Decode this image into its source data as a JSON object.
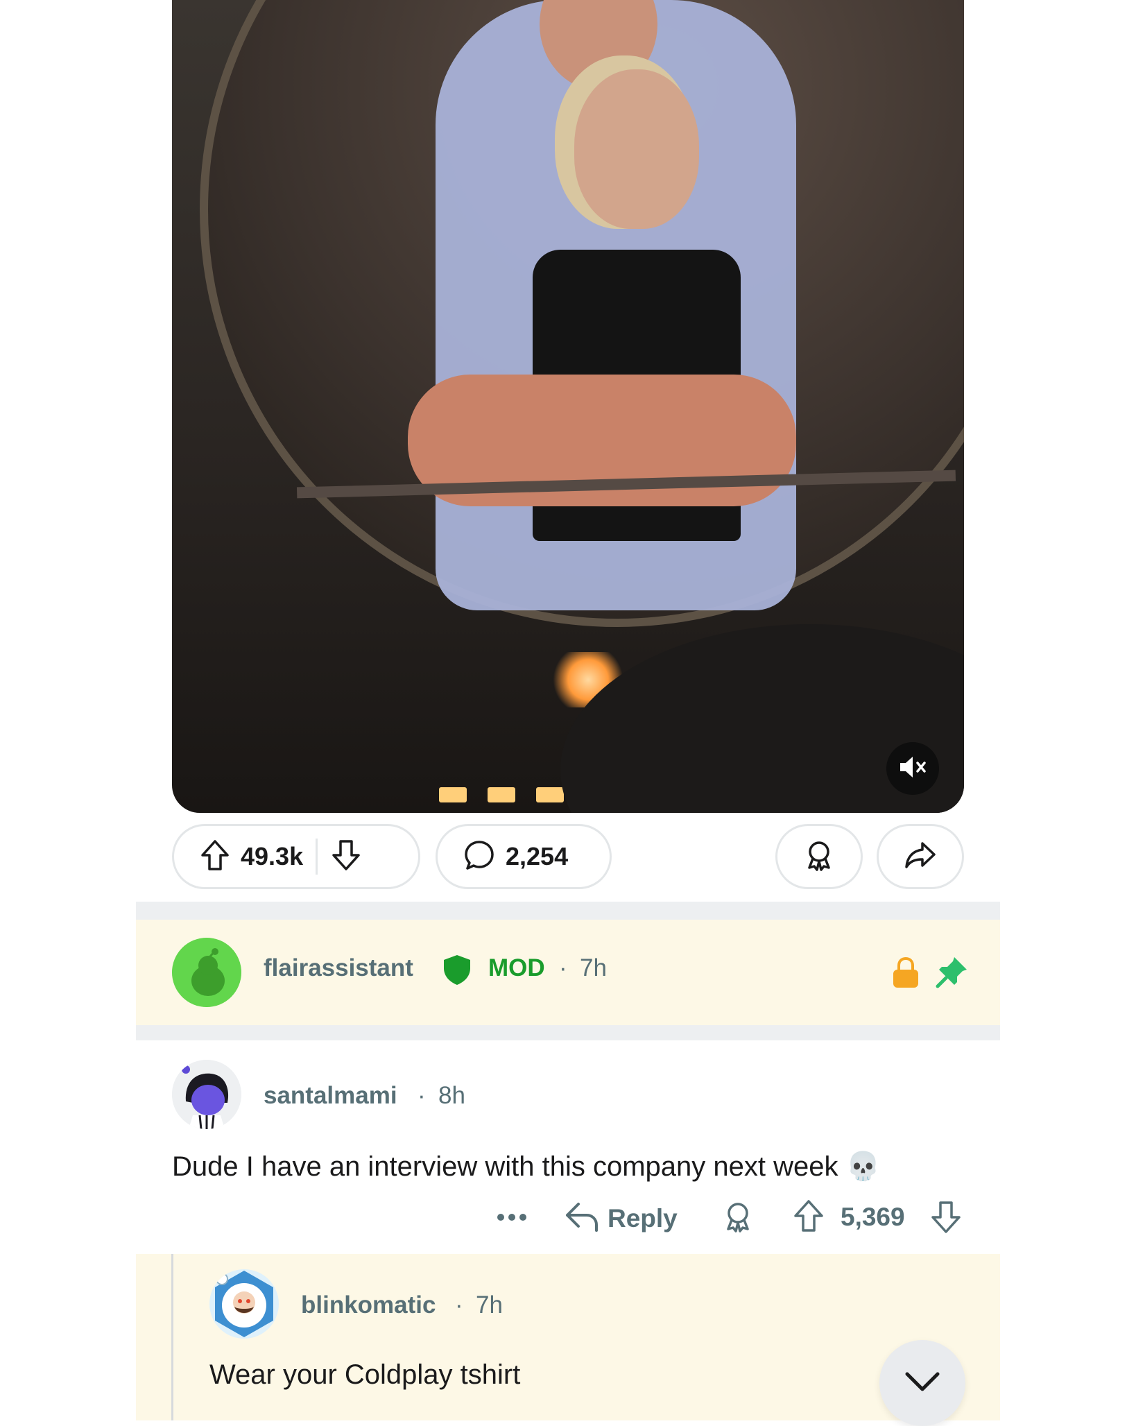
{
  "post": {
    "upvotes": "49.3k",
    "comments_count": "2,254"
  },
  "mod_comment": {
    "username": "flairassistant",
    "badge": "MOD",
    "time": "7h"
  },
  "comment1": {
    "username": "santalmami",
    "time": "8h",
    "body": "Dude I have an interview with this company next week 💀",
    "reply_label": "Reply",
    "score": "5,369"
  },
  "comment2": {
    "username": "blinkomatic",
    "time": "7h",
    "body": "Wear your Coldplay tshirt"
  },
  "icons": {
    "mute": "mute-icon",
    "upvote": "upvote-icon",
    "downvote": "downvote-icon",
    "comment": "comment-icon",
    "award": "award-icon",
    "share": "share-icon",
    "mod_shield": "shield-icon",
    "lock": "lock-icon",
    "pin": "pin-icon",
    "more": "more-icon",
    "reply": "reply-icon",
    "chevron": "chevron-down-icon"
  },
  "colors": {
    "mod_green": "#1a9c2c",
    "pin_green": "#2dbf6c",
    "lock_orange": "#f5a623",
    "highlight_bg": "#fdf8e6",
    "meta_gray": "#576f76"
  }
}
